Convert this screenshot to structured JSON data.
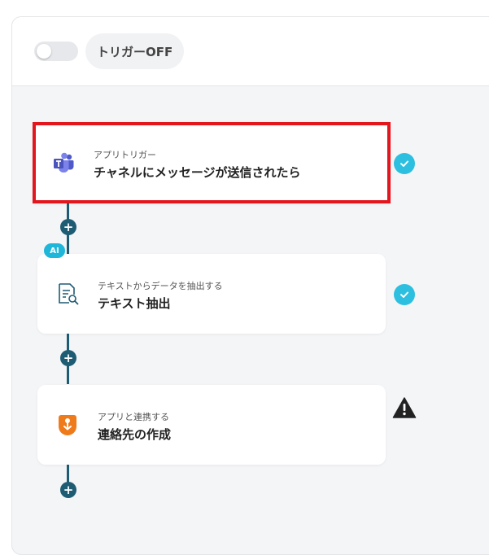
{
  "header": {
    "trigger_toggle_state": "off",
    "trigger_label": "トリガーOFF"
  },
  "flow": {
    "steps": [
      {
        "subtitle": "アプリトリガー",
        "title": "チャネルにメッセージが送信されたら",
        "icon": "teams-icon",
        "status": "complete",
        "highlighted": true
      },
      {
        "subtitle": "テキストからデータを抽出する",
        "title": "テキスト抽出",
        "icon": "document-search-icon",
        "badge": "AI",
        "status": "complete"
      },
      {
        "subtitle": "アプリと連携する",
        "title": "連絡先の作成",
        "icon": "app-integration-icon",
        "status": "warning"
      }
    ],
    "add_step_symbol": "+"
  },
  "colors": {
    "connector": "#1e5c73",
    "check": "#2cbfe0",
    "highlight_border": "#e3151d",
    "ai_badge": "#1fb7d9",
    "app_icon": "#ef7a1a",
    "teams_icon": "#5059c9"
  }
}
